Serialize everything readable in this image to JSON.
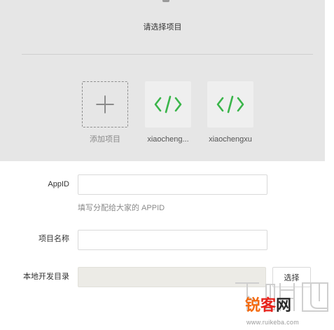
{
  "project_picker": {
    "title": "请选择项目",
    "items": [
      {
        "label": "添加项目",
        "icon": "plus-icon"
      },
      {
        "label": "xiaocheng...",
        "icon": "code-icon"
      },
      {
        "label": "xiaochengxu",
        "icon": "code-icon"
      }
    ]
  },
  "form": {
    "appid": {
      "label": "AppID",
      "value": "",
      "hint": "填写分配给大家的 APPID"
    },
    "project_name": {
      "label": "项目名称",
      "value": ""
    },
    "local_dir": {
      "label": "本地开发目录",
      "value": "",
      "button_label": "选择"
    }
  },
  "watermark": {
    "brand_part1": "锐",
    "brand_part2": "客",
    "brand_part3": "网",
    "url": "www.ruikeba.com"
  },
  "colors": {
    "panel_bg": "#e6e6e6",
    "tile_bg": "#efefef",
    "code_green": "#3ab54a",
    "plus_gray": "#8a8a8a",
    "readonly_bg": "#ecebe6",
    "brand_orange": "#f46a0f",
    "brand_red": "#e8231c"
  }
}
